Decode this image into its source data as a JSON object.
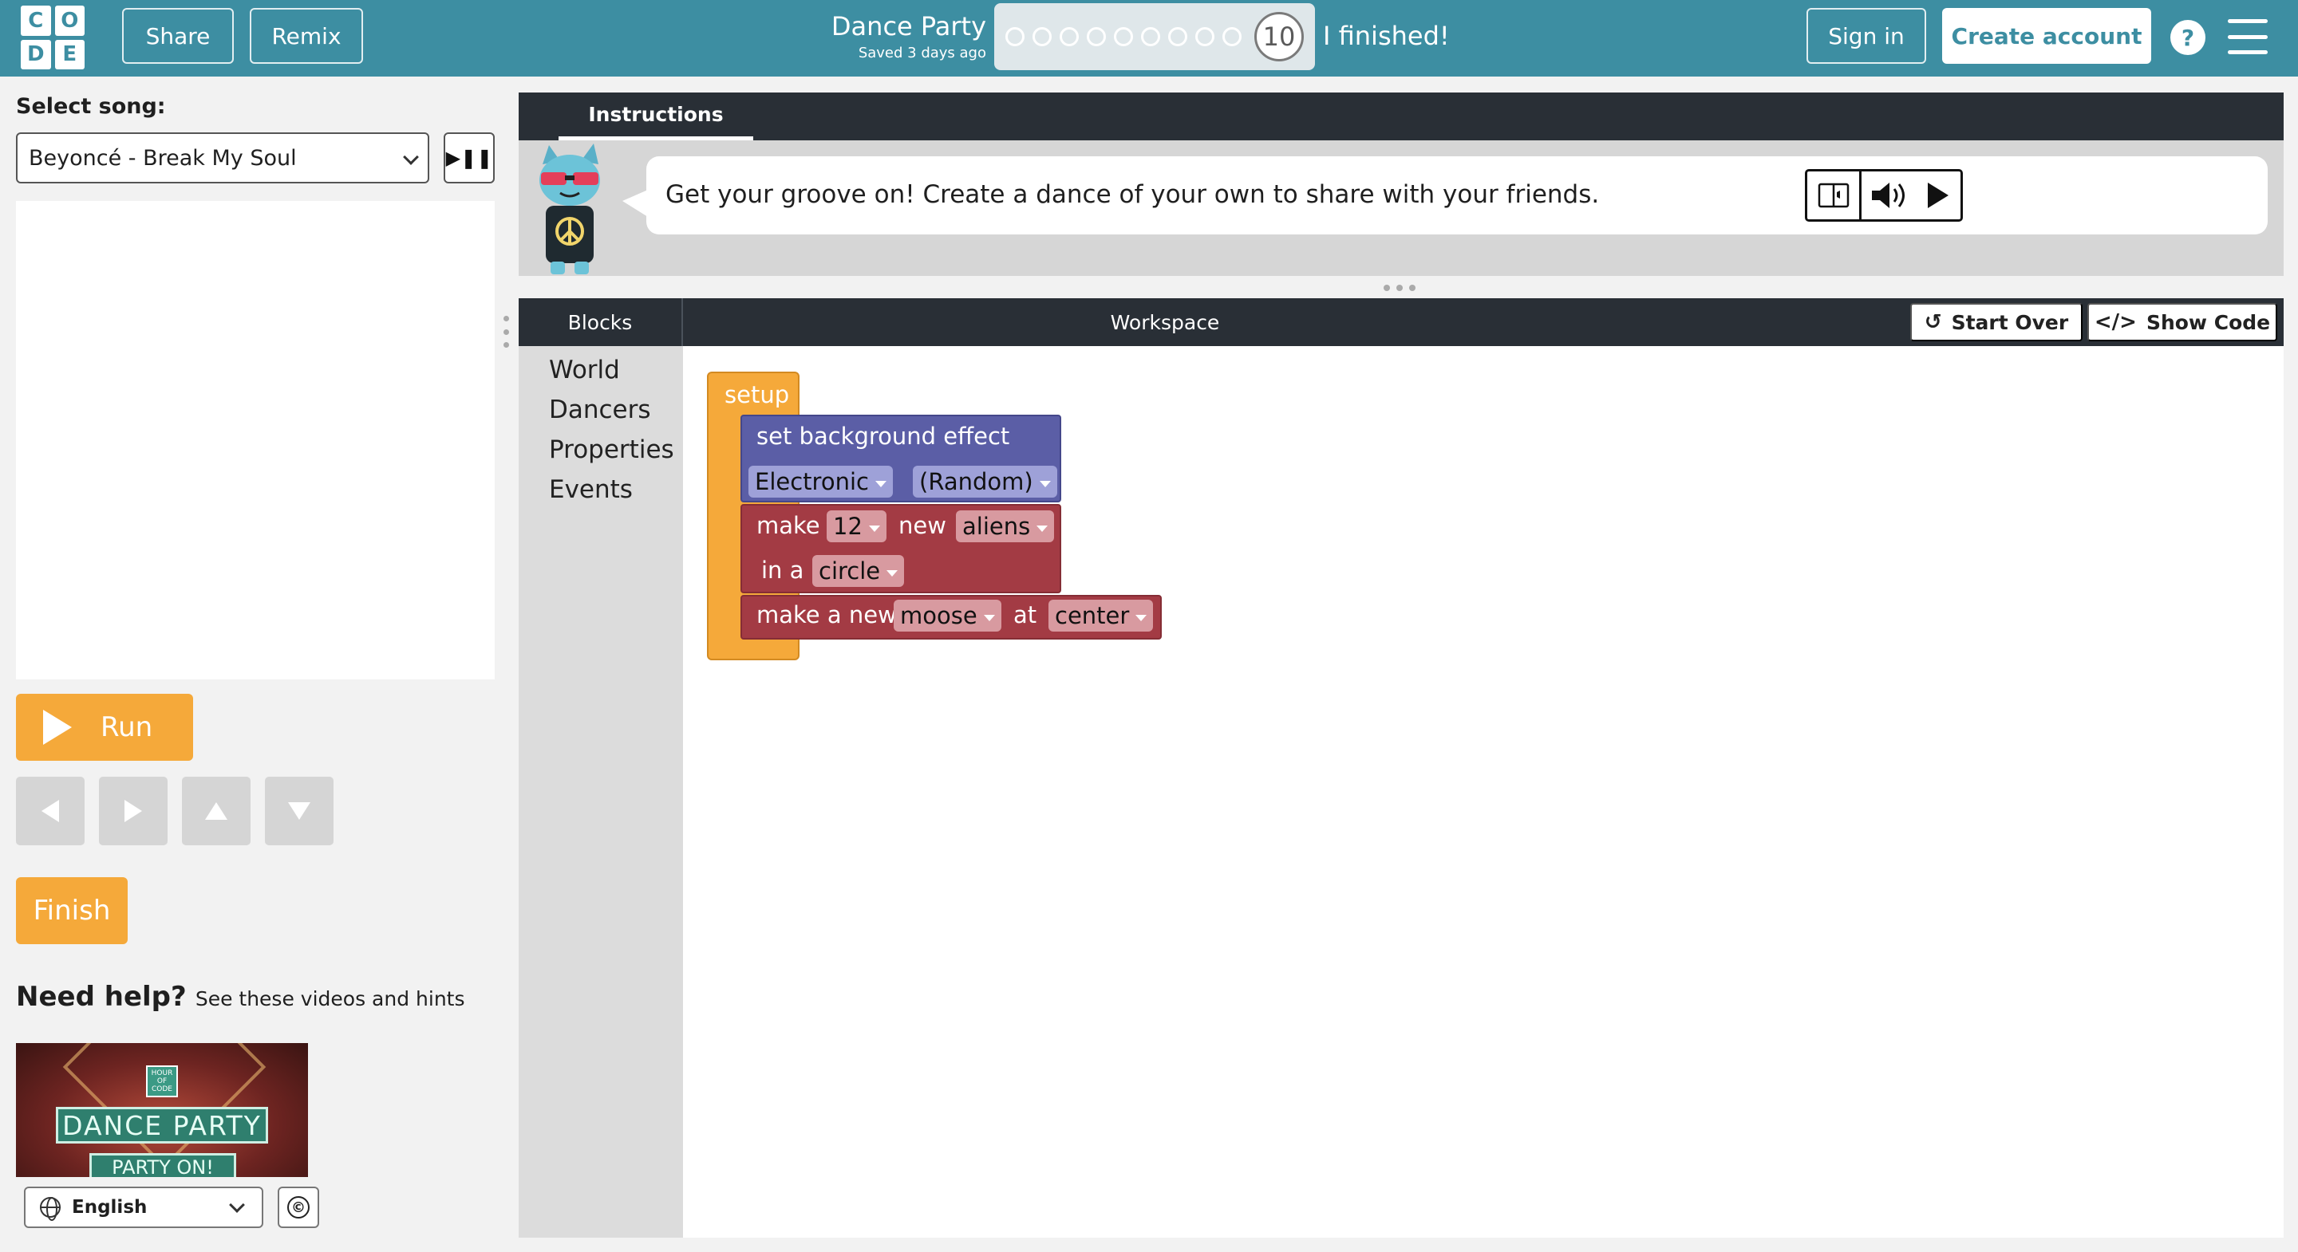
{
  "header": {
    "logo_letters": [
      "C",
      "O",
      "D",
      "E"
    ],
    "share_label": "Share",
    "remix_label": "Remix",
    "project_title": "Dance Party",
    "saved_status": "Saved 3 days ago",
    "progress_dots_count": 9,
    "level_number": "10",
    "finished_label": "I finished!",
    "signin_label": "Sign in",
    "create_account_label": "Create account",
    "help_icon": "?",
    "accent_color": "#3d8ea2"
  },
  "left_panel": {
    "select_song_label": "Select song:",
    "selected_song": "Beyoncé - Break My Soul",
    "play_pause_icon": "▶❚❚",
    "run_label": "Run",
    "finish_label": "Finish",
    "help_title": "Need help?",
    "help_subtitle": "See these videos and hints",
    "video": {
      "badge_text": "HOUR OF CODE",
      "title": "DANCE PARTY",
      "subtitle": "PARTY ON!"
    },
    "language": "English",
    "copyright_icon": "©",
    "button_color": "#f5a93a"
  },
  "instructions": {
    "tab_label": "Instructions",
    "text": "Get your groove on! Create a dance of your own to share with your friends."
  },
  "workspace": {
    "blocks_header": "Blocks",
    "workspace_title": "Workspace",
    "start_over_label": "Start Over",
    "show_code_label": "Show Code",
    "start_over_icon": "↺",
    "show_code_icon": "</>",
    "categories": [
      "World",
      "Dancers",
      "Properties",
      "Events"
    ],
    "program": {
      "setup_label": "setup",
      "background_block": {
        "label": "set background effect",
        "effect": "Electronic",
        "palette": "(Random)"
      },
      "make_group_block": {
        "make": "make",
        "count": "12",
        "new": "new",
        "dancer": "aliens",
        "in_a": "in a",
        "layout": "circle"
      },
      "make_one_block": {
        "make_a_new": "make a new",
        "dancer": "moose",
        "at": "at",
        "location": "center"
      }
    }
  }
}
